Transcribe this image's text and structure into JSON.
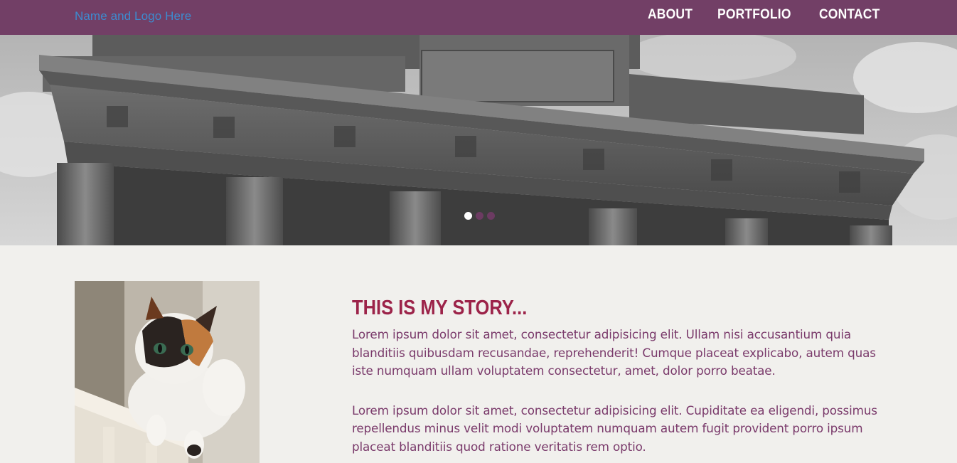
{
  "header": {
    "brand": "Name and Logo Here",
    "nav": [
      "ABOUT",
      "PORTFOLIO",
      "CONTACT"
    ]
  },
  "hero": {
    "slide_count": 3,
    "active_slide": 1
  },
  "story": {
    "title": "THIS IS MY STORY...",
    "paragraphs": [
      "Lorem ipsum dolor sit amet, consectetur adipisicing elit. Ullam nisi accusantium quia blanditiis quibusdam recusandae, reprehenderit! Cumque placeat explicabo, autem quas iste numquam ullam voluptatem consectetur, amet, dolor porro beatae.",
      "Lorem ipsum dolor sit amet, consectetur adipisicing elit. Cupiditate ea eligendi, possimus repellendus minus velit modi voluptatem numquam autem fugit provident porro ipsum placeat blanditiis quod ratione veritatis rem optio."
    ]
  },
  "colors": {
    "header_bg": "#723f66",
    "brand_link": "#3d8bcf",
    "title": "#9c2349",
    "body_text": "#7a3a6b",
    "page_bg": "#f1f0ed"
  }
}
